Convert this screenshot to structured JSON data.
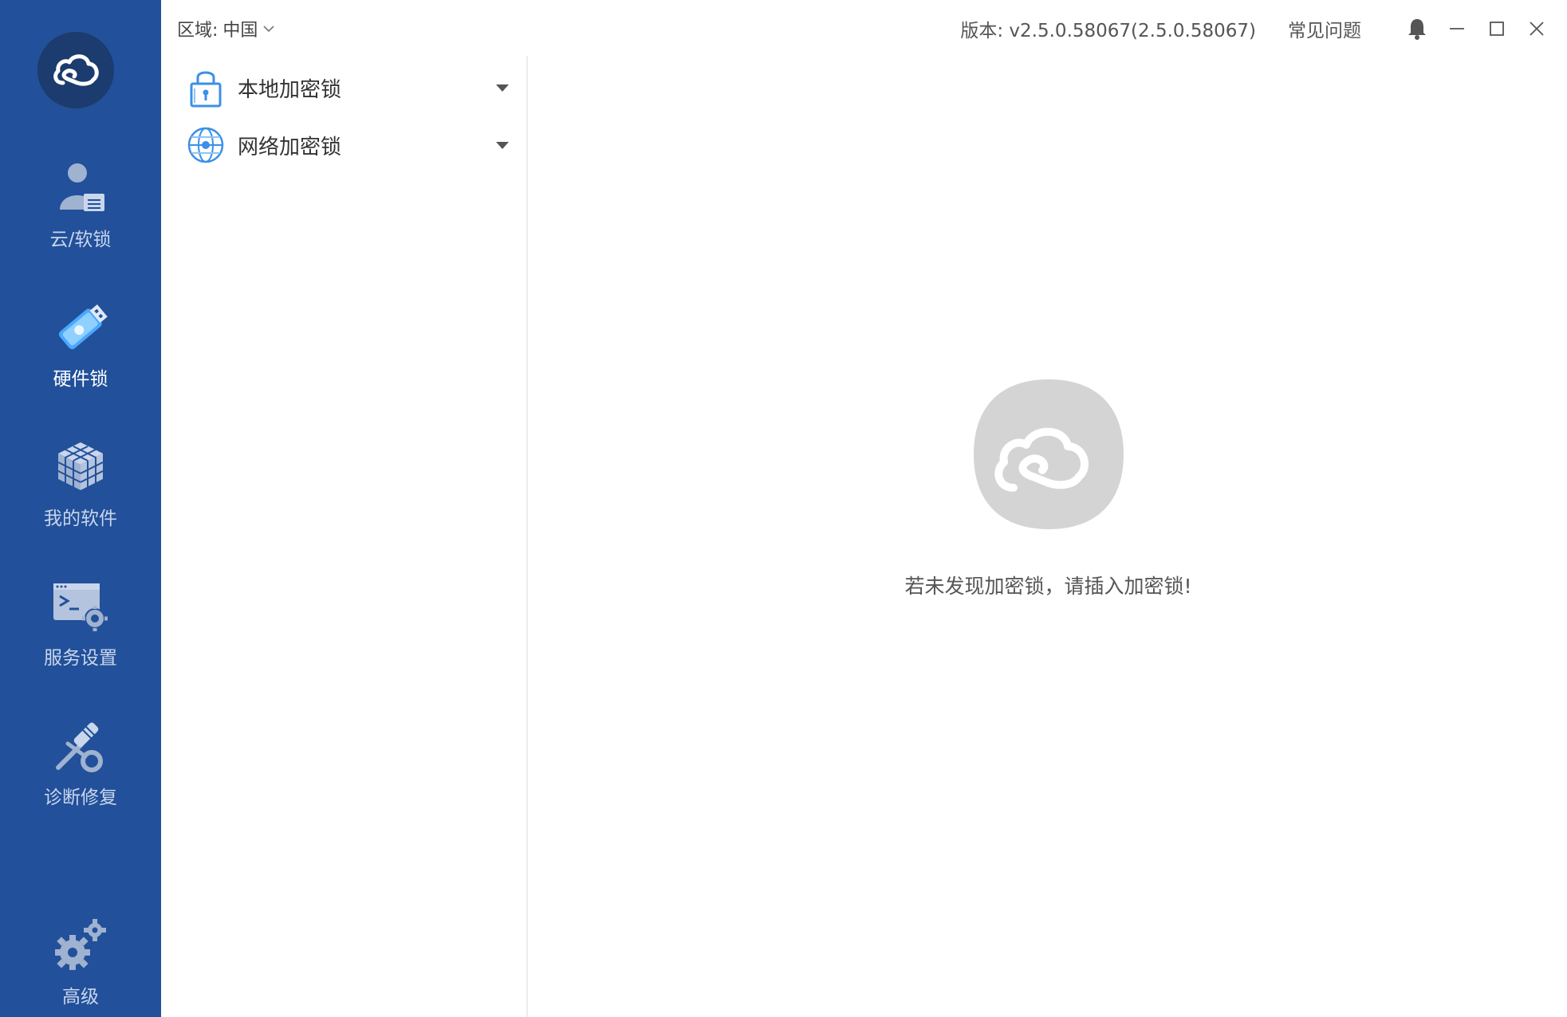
{
  "nav": {
    "logo_icon": "cloud-lock-logo-icon",
    "items": [
      {
        "label": "云/软锁",
        "icon": "user-card-icon",
        "active": false
      },
      {
        "label": "硬件锁",
        "icon": "usb-dongle-icon",
        "active": true
      },
      {
        "label": "我的软件",
        "icon": "cube-grid-icon",
        "active": false
      },
      {
        "label": "服务设置",
        "icon": "terminal-gear-icon",
        "active": false
      },
      {
        "label": "诊断修复",
        "icon": "repair-tools-icon",
        "active": false
      },
      {
        "label": "高级",
        "icon": "gears-icon",
        "active": false
      }
    ]
  },
  "topbar": {
    "region_label": "区域:",
    "region_value": "中国",
    "version": "版本: v2.5.0.58067(2.5.0.58067)",
    "faq": "常见问题"
  },
  "tree": {
    "items": [
      {
        "label": "本地加密锁",
        "icon": "padlock-icon"
      },
      {
        "label": "网络加密锁",
        "icon": "globe-icon"
      }
    ]
  },
  "empty_state": {
    "message": "若未发现加密锁，请插入加密锁!"
  },
  "colors": {
    "nav_bg": "#22509a",
    "accent": "#3b8fe8"
  }
}
